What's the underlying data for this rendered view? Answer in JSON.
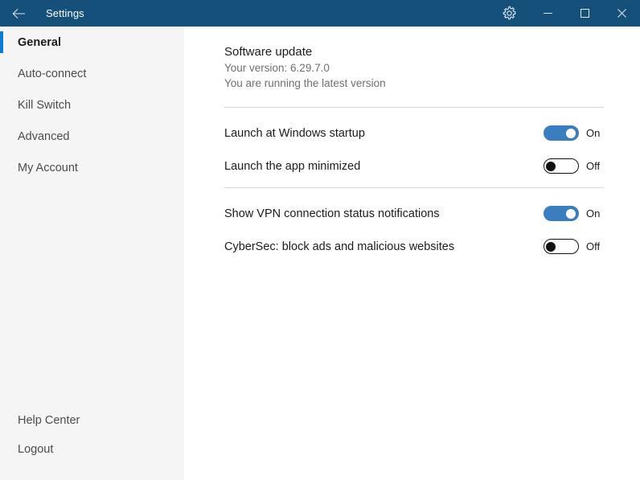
{
  "titlebar": {
    "back_icon": "back-arrow-icon",
    "title": "Settings",
    "gear_icon": "gear-icon",
    "minimize_icon": "minimize-icon",
    "maximize_icon": "maximize-icon",
    "close_icon": "close-icon",
    "background_color": "#15507b"
  },
  "sidebar": {
    "background_color": "#f5f5f5",
    "accent_color": "#0a7cd1",
    "items": [
      {
        "label": "General",
        "active": true
      },
      {
        "label": "Auto-connect",
        "active": false
      },
      {
        "label": "Kill Switch",
        "active": false
      },
      {
        "label": "Advanced",
        "active": false
      },
      {
        "label": "My Account",
        "active": false
      }
    ],
    "bottom_items": [
      {
        "label": "Help Center"
      },
      {
        "label": "Logout"
      }
    ]
  },
  "main": {
    "update": {
      "title": "Software update",
      "version_line": "Your version: 6.29.7.0",
      "status_line": "You are running the latest version"
    },
    "groups": [
      {
        "rows": [
          {
            "label": "Launch at Windows startup",
            "state": "On",
            "on": true
          },
          {
            "label": "Launch the app minimized",
            "state": "Off",
            "on": false
          }
        ]
      },
      {
        "rows": [
          {
            "label": "Show VPN connection status notifications",
            "state": "On",
            "on": true
          },
          {
            "label": "CyberSec: block ads and malicious websites",
            "state": "Off",
            "on": false
          }
        ]
      }
    ],
    "toggle_on_color": "#3a7ebf",
    "toggle_off_color": "#101010"
  }
}
